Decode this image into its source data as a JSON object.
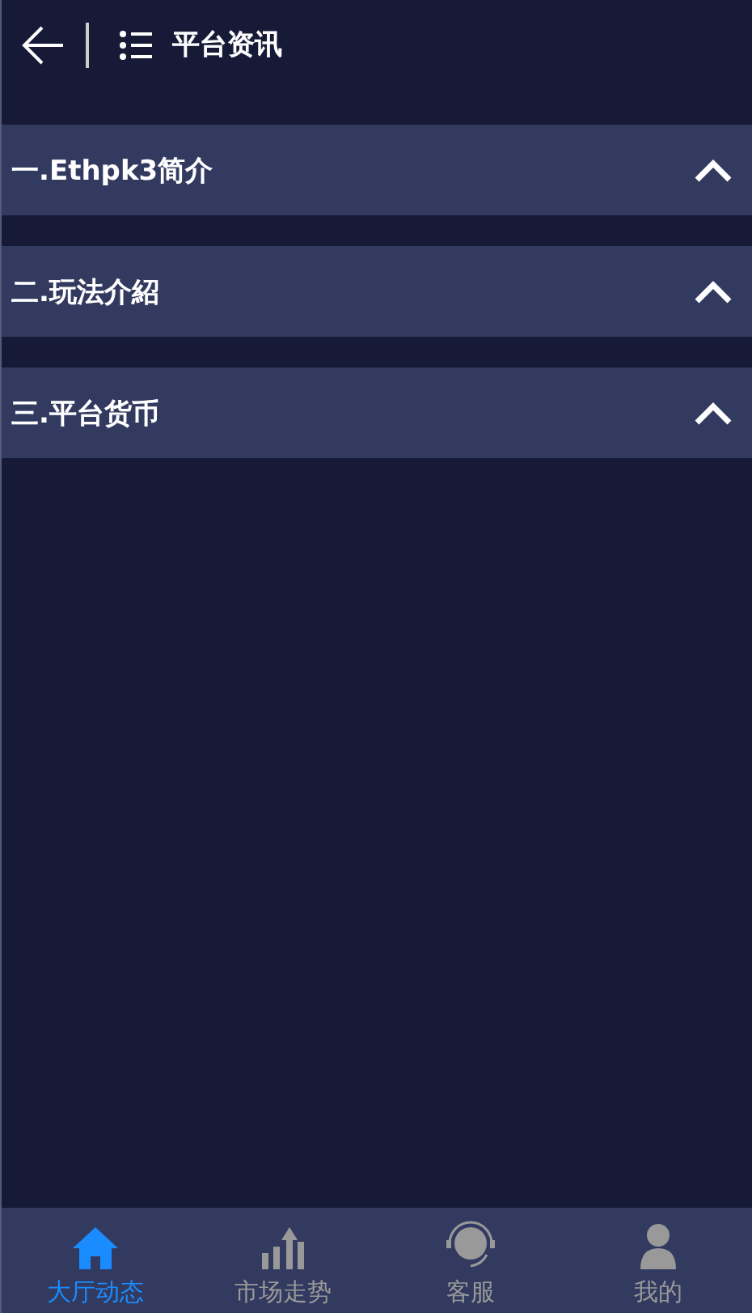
{
  "header": {
    "title": "平台资讯"
  },
  "sections": [
    {
      "title": "一.Ethpk3简介"
    },
    {
      "title": "二.玩法介紹"
    },
    {
      "title": "三.平台货币"
    }
  ],
  "tabbar": [
    {
      "kind": "home",
      "label": "大厅动态",
      "selected": true
    },
    {
      "kind": "chart",
      "label": "市场走势",
      "selected": false
    },
    {
      "kind": "support",
      "label": "客服",
      "selected": false
    },
    {
      "kind": "user",
      "label": "我的",
      "selected": false
    }
  ]
}
